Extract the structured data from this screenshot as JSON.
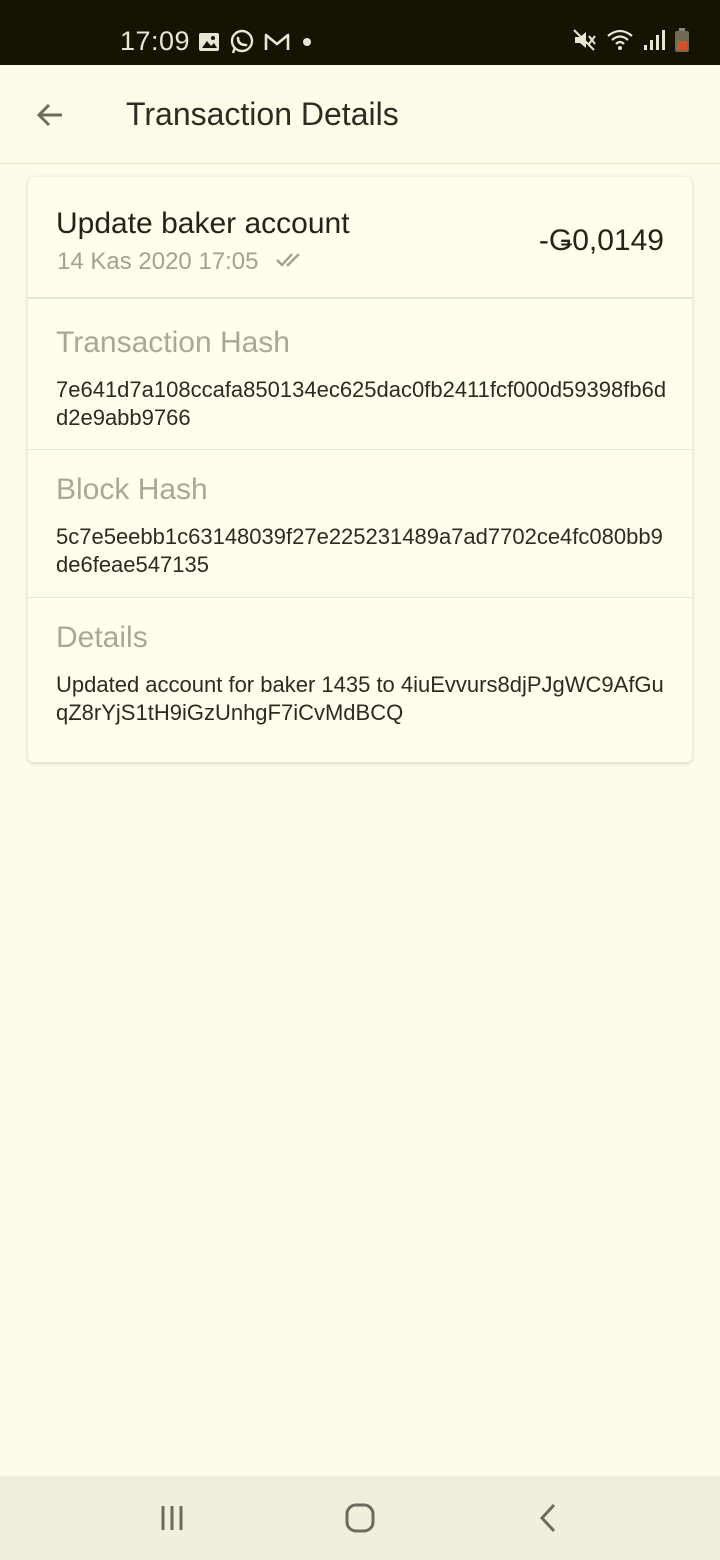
{
  "status_bar": {
    "time": "17:09",
    "left_icons": [
      "image-icon",
      "whatsapp-icon",
      "gmail-icon",
      "dot-icon"
    ],
    "right_icons": [
      "mute-icon",
      "wifi-icon",
      "signal-icon",
      "battery-icon"
    ]
  },
  "app_bar": {
    "title": "Transaction Details",
    "back_icon": "arrow-left-icon"
  },
  "transaction": {
    "title": "Update baker account",
    "date": "14 Kas 2020 17:05",
    "status_icon": "double-check-icon",
    "amount": "-Ǥ0,0149"
  },
  "sections": [
    {
      "label": "Transaction Hash",
      "value": "7e641d7a108ccafa850134ec625dac0fb2411fcf000d59398fb6dd2e9abb9766"
    },
    {
      "label": "Block Hash",
      "value": "5c7e5eebb1c63148039f27e225231489a7ad7702ce4fc080bb9de6feae547135"
    },
    {
      "label": "Details",
      "value": "Updated account for baker 1435 to 4iuEvvurs8djPJgWC9AfGuqZ8rYjS1tH9iGzUnhgF7iCvMdBCQ"
    }
  ],
  "nav_bar": {
    "buttons": [
      "recent-apps-icon",
      "home-icon",
      "back-icon"
    ]
  },
  "colors": {
    "background": "#fefce8",
    "status_bar": "#161305",
    "label_gray": "#a8a89a",
    "text_dark": "#23231c"
  }
}
